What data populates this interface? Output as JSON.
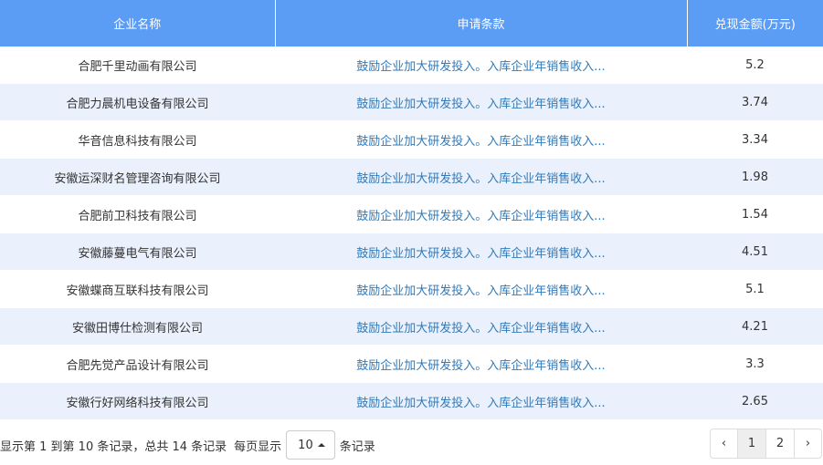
{
  "table": {
    "headers": [
      "企业名称",
      "申请条款",
      "兑现金额(万元)"
    ],
    "rows": [
      {
        "company": "合肥千里动画有限公司",
        "clause": "鼓励企业加大研发投入。入库企业年销售收入...",
        "amount": "5.2"
      },
      {
        "company": "合肥力晨机电设备有限公司",
        "clause": "鼓励企业加大研发投入。入库企业年销售收入...",
        "amount": "3.74"
      },
      {
        "company": "华音信息科技有限公司",
        "clause": "鼓励企业加大研发投入。入库企业年销售收入...",
        "amount": "3.34"
      },
      {
        "company": "安徽运深财名管理咨询有限公司",
        "clause": "鼓励企业加大研发投入。入库企业年销售收入...",
        "amount": "1.98"
      },
      {
        "company": "合肥前卫科技有限公司",
        "clause": "鼓励企业加大研发投入。入库企业年销售收入...",
        "amount": "1.54"
      },
      {
        "company": "安徽藤蔓电气有限公司",
        "clause": "鼓励企业加大研发投入。入库企业年销售收入...",
        "amount": "4.51"
      },
      {
        "company": "安徽蝶商互联科技有限公司",
        "clause": "鼓励企业加大研发投入。入库企业年销售收入...",
        "amount": "5.1"
      },
      {
        "company": "安徽田博仕检测有限公司",
        "clause": "鼓励企业加大研发投入。入库企业年销售收入...",
        "amount": "4.21"
      },
      {
        "company": "合肥先觉产品设计有限公司",
        "clause": "鼓励企业加大研发投入。入库企业年销售收入...",
        "amount": "3.3"
      },
      {
        "company": "安徽行好网络科技有限公司",
        "clause": "鼓励企业加大研发投入。入库企业年销售收入...",
        "amount": "2.65"
      }
    ]
  },
  "footer": {
    "summary": "显示第 1 到第 10 条记录，总共 14 条记录",
    "per_page_label": "每页显示",
    "page_size": "10",
    "records_suffix": "条记录"
  },
  "pagination": {
    "prev": "‹",
    "pages": [
      "1",
      "2"
    ],
    "active_page": "1",
    "next": "›"
  },
  "colors": {
    "header_bg": "#5b9cf5",
    "stripe_bg": "#eaf1fd",
    "link": "#337ab7"
  }
}
